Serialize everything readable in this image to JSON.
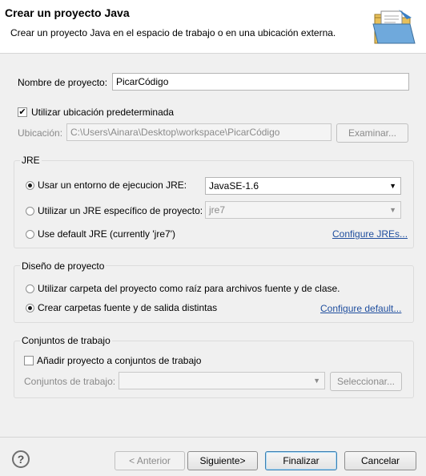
{
  "header": {
    "title": "Crear un proyecto Java",
    "subtitle": "Crear un proyecto Java en el espacio de trabajo o en una ubicación externa.",
    "icon": "folder-icon"
  },
  "project": {
    "name_label": "Nombre de proyecto:",
    "name_value": "PicarCódigo",
    "use_default_label": "Utilizar ubicación predeterminada",
    "use_default_checked": true,
    "location_label": "Ubicación:",
    "location_value": "C:\\Users\\Ainara\\Desktop\\workspace\\PicarCódigo",
    "browse_label": "Examinar..."
  },
  "jre": {
    "title": "JRE",
    "options": [
      {
        "label": "Usar un entorno de ejecucion JRE:",
        "selected": true,
        "value": "JavaSE-1.6"
      },
      {
        "label": "Utilizar un JRE específico de proyecto:",
        "selected": false,
        "value": "jre7"
      },
      {
        "label": "Use default JRE (currently 'jre7')",
        "selected": false
      }
    ],
    "configure_link": "Configure JREs..."
  },
  "layout": {
    "title": "Diseño de proyecto",
    "options": [
      {
        "label": "Utilizar carpeta del proyecto como raíz para archivos fuente y de clase.",
        "selected": false
      },
      {
        "label": "Crear carpetas fuente y de salida distintas",
        "selected": true
      }
    ],
    "configure_link": "Configure default..."
  },
  "working_sets": {
    "title": "Conjuntos de trabajo",
    "add_label": "Añadir proyecto a conjuntos de trabajo",
    "add_checked": false,
    "sets_label": "Conjuntos de trabajo:",
    "sets_value": "",
    "select_label": "Seleccionar..."
  },
  "footer": {
    "help_icon": "help-icon",
    "help_glyph": "?",
    "back_label": "< Anterior",
    "next_label": "Siguiente>",
    "finish_label": "Finalizar",
    "cancel_label": "Cancelar"
  },
  "colors": {
    "link": "#1f4e9e",
    "primary_border": "#3c7fb1"
  }
}
